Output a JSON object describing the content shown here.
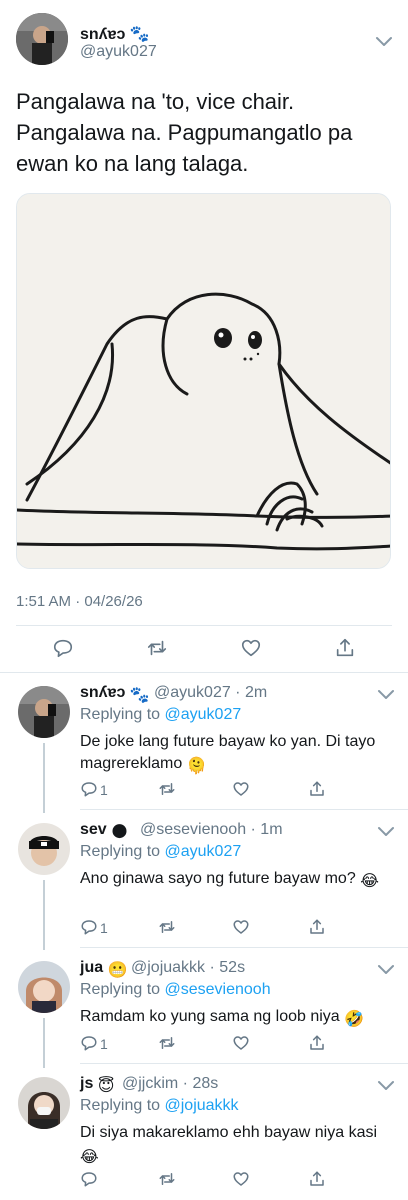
{
  "main_tweet": {
    "display_name": "ѕnʎɐɔ 🐾",
    "handle": "@ayuk027",
    "text": "Pangalawa na 'to, vice chair.\nPangalawa na. Pagpumangatlo pa\newan ko na lang talaga.",
    "timestamp": "1:51 AM · 04/26/26",
    "media_icon": "drawing-of-creature-at-table"
  },
  "replies": [
    {
      "display_name": "ѕnʎɐɔ",
      "emoji": "🐾",
      "meta": "@ayuk027 · 2m",
      "replying_prefix": "Replying to ",
      "replying_to": "@ayuk027",
      "text": "De joke lang future bayaw ko yan. Di tayo magrereklamo",
      "text_emoji": "🫠",
      "reply_count": "1"
    },
    {
      "display_name": "sev",
      "emoji": "🌑",
      "meta": "@sesevienooh · 1m",
      "replying_prefix": "Replying to ",
      "replying_to": "@ayuk027",
      "text": "Ano ginawa sayo ng future bayaw mo?",
      "text_emoji": "😂",
      "reply_count": "1"
    },
    {
      "display_name": "jua",
      "emoji": "😬",
      "meta": "@jojuakkk · 52s",
      "replying_prefix": "Replying to ",
      "replying_to": "@sesevienooh",
      "text": "Ramdam ko yung sama ng loob niya",
      "text_emoji": "🤣",
      "reply_count": "1"
    },
    {
      "display_name": "js",
      "emoji": "😇",
      "meta": "@jjckim · 28s",
      "replying_prefix": "Replying to ",
      "replying_to": "@jojuakkk",
      "text": "Di siya makareklamo ehh bayaw niya kasi",
      "text_emoji": "😂",
      "reply_count": ""
    }
  ],
  "colors": {
    "accent": "#1da1f2",
    "secondary_text": "#657786",
    "divider": "#e1e8ed",
    "icon": "#657786"
  }
}
